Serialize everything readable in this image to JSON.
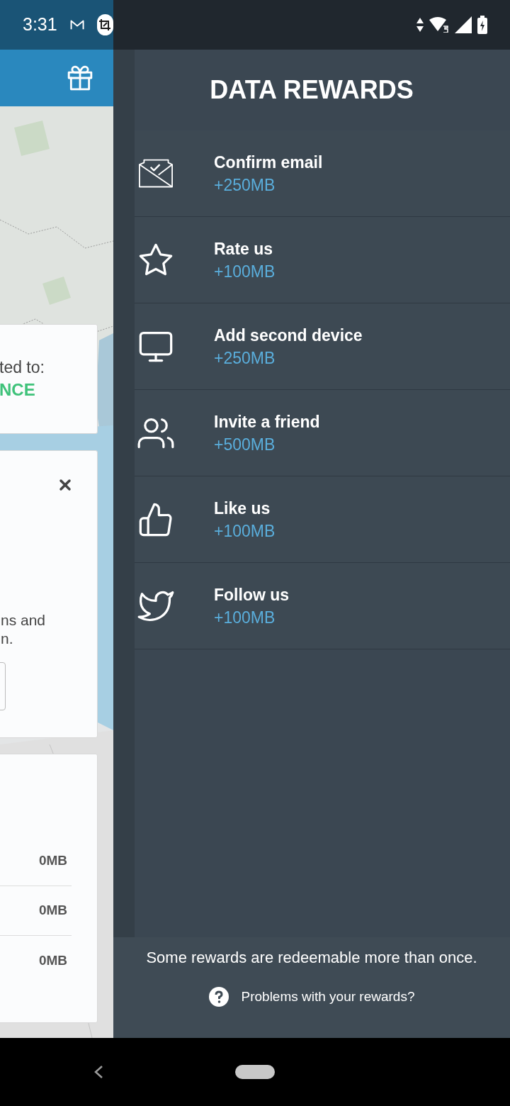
{
  "status_bar": {
    "time": "3:31"
  },
  "background_app": {
    "connection_card": {
      "text": "ted to:",
      "location": "NCE"
    },
    "info_card": {
      "lines": [
        "ns and",
        "n."
      ]
    },
    "usage_card": {
      "rows": [
        "0MB",
        "0MB",
        "0MB"
      ]
    }
  },
  "drawer": {
    "title": "DATA REWARDS",
    "rewards": [
      {
        "kind": "email",
        "label": "Confirm email",
        "amount": "+250MB"
      },
      {
        "kind": "rate",
        "label": "Rate us",
        "amount": "+100MB"
      },
      {
        "kind": "device",
        "label": "Add second device",
        "amount": "+250MB"
      },
      {
        "kind": "invite",
        "label": "Invite a friend",
        "amount": "+500MB"
      },
      {
        "kind": "like",
        "label": "Like us",
        "amount": "+100MB"
      },
      {
        "kind": "follow",
        "label": "Follow us",
        "amount": "+100MB"
      }
    ],
    "footer_note": "Some rewards are redeemable more than once.",
    "help_link": "Problems with your rewards?"
  }
}
